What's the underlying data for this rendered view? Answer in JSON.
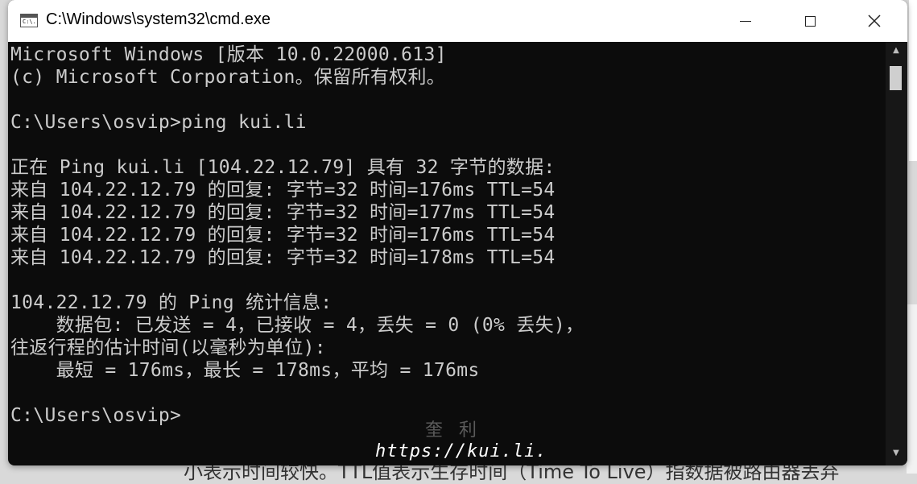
{
  "window": {
    "title": "C:\\Windows\\system32\\cmd.exe",
    "icon": "cmd-icon",
    "icon_text": "C:\\."
  },
  "console": {
    "lines": [
      "Microsoft Windows [版本 10.0.22000.613]",
      "(c) Microsoft Corporation。保留所有权利。",
      "",
      "C:\\Users\\osvip>ping kui.li",
      "",
      "正在 Ping kui.li [104.22.12.79] 具有 32 字节的数据:",
      "来自 104.22.12.79 的回复: 字节=32 时间=176ms TTL=54",
      "来自 104.22.12.79 的回复: 字节=32 时间=177ms TTL=54",
      "来自 104.22.12.79 的回复: 字节=32 时间=176ms TTL=54",
      "来自 104.22.12.79 的回复: 字节=32 时间=178ms TTL=54",
      "",
      "104.22.12.79 的 Ping 统计信息:",
      "    数据包: 已发送 = 4，已接收 = 4，丢失 = 0 (0% 丢失)，",
      "往返行程的估计时间(以毫秒为单位):",
      "    最短 = 176ms，最长 = 178ms，平均 = 176ms",
      "",
      "C:\\Users\\osvip>"
    ]
  },
  "watermark": {
    "cn": "奎利",
    "url": "https://kui.li."
  },
  "background": {
    "partial_text": "小表示时间较快。TTL值表示生存时间（Time To Live）指数据被路由器丢弃"
  }
}
